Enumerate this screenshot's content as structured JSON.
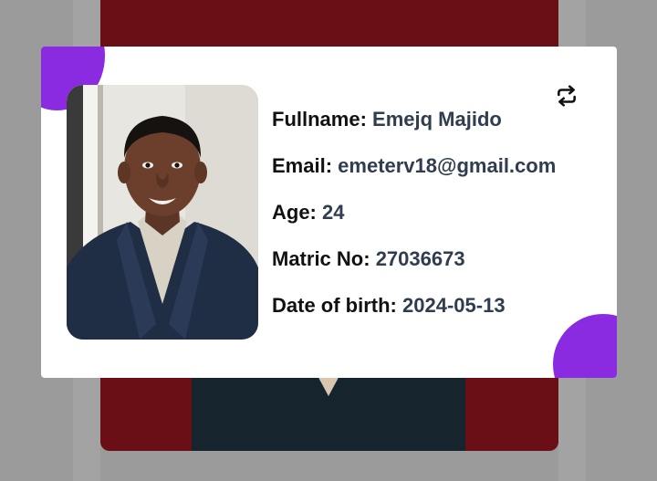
{
  "profile": {
    "fullname_label": "Fullname:",
    "fullname_value": "Emejq Majido",
    "email_label": "Email:",
    "email_value": "emeterv18@gmail.com",
    "age_label": "Age:",
    "age_value": "24",
    "matric_label": "Matric No:",
    "matric_value": "27036673",
    "dob_label": "Date of birth:",
    "dob_value": "2024-05-13"
  },
  "icons": {
    "swap": "repeat-icon"
  },
  "colors": {
    "accent": "#8a2be2",
    "back_card": "#6a0f15",
    "value_text": "#2f3d4f",
    "background": "#9b9b9b"
  }
}
